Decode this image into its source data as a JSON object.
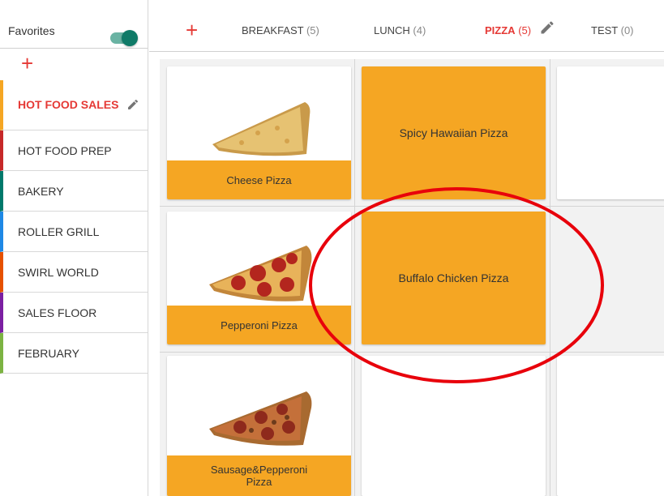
{
  "sidebar": {
    "favorites_label": "Favorites",
    "favorites_on": true,
    "add_symbol": "+",
    "categories": [
      {
        "label": "HOT FOOD SALES",
        "color": "#f5a623",
        "active": true
      },
      {
        "label": "HOT FOOD PREP",
        "color": "#c62828"
      },
      {
        "label": "BAKERY",
        "color": "#00796b"
      },
      {
        "label": "ROLLER GRILL",
        "color": "#1e88e5"
      },
      {
        "label": "SWIRL WORLD",
        "color": "#e65100"
      },
      {
        "label": "SALES FLOOR",
        "color": "#7b1fa2"
      },
      {
        "label": "FEBRUARY",
        "color": "#7cb342"
      }
    ]
  },
  "tabs": {
    "add_symbol": "+",
    "items": [
      {
        "label": "BREAKFAST",
        "count": "(5)"
      },
      {
        "label": "LUNCH",
        "count": "(4)"
      },
      {
        "label": "PIZZA",
        "count": "(5)",
        "active": true
      },
      {
        "label": "TEST",
        "count": "(0)"
      }
    ]
  },
  "grid": {
    "items": [
      {
        "label": "Cheese Pizza",
        "image": "cheese-pizza-slice"
      },
      {
        "label": "Spicy Hawaiian Pizza"
      },
      {
        "label": "Pepperoni Pizza",
        "image": "pepperoni-pizza-slice"
      },
      {
        "label": "Buffalo Chicken Pizza"
      },
      {
        "label": "Sausage&Pepperoni Pizza",
        "image": "sausage-pepperoni-pizza-slice"
      }
    ]
  },
  "colors": {
    "accent": "#e53935",
    "tile": "#f5a623",
    "toggle": "#0f7a67",
    "annotation": "#e8000b"
  }
}
